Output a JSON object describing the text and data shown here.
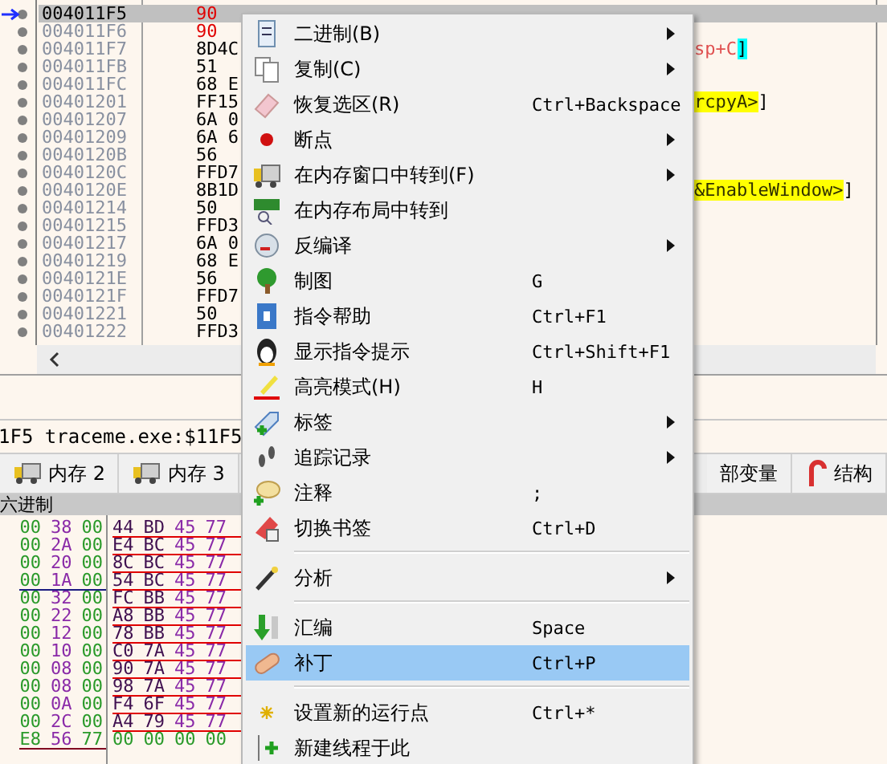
{
  "disassembly": {
    "rows": [
      {
        "address": "004011F5",
        "bytes": "90",
        "selected": true,
        "kind": "nop"
      },
      {
        "address": "004011F6",
        "bytes": "90",
        "selected": false,
        "kind": "nop"
      },
      {
        "address": "004011F7",
        "bytes": "8D4C",
        "selected": false,
        "kind": "normal",
        "tail": {
          "text": "sp+C",
          "end": "]",
          "kind": "register"
        }
      },
      {
        "address": "004011FB",
        "bytes": "51",
        "selected": false,
        "kind": "normal"
      },
      {
        "address": "004011FC",
        "bytes": "68 E",
        "selected": false,
        "kind": "normal"
      },
      {
        "address": "00401201",
        "bytes": "FF15",
        "selected": false,
        "kind": "normal",
        "tail": {
          "text": "rcpyA>",
          "end": "]",
          "kind": "symbol"
        }
      },
      {
        "address": "00401207",
        "bytes": "6A 0",
        "selected": false,
        "kind": "normal"
      },
      {
        "address": "00401209",
        "bytes": "6A 6",
        "selected": false,
        "kind": "normal"
      },
      {
        "address": "0040120B",
        "bytes": "56",
        "selected": false,
        "kind": "normal"
      },
      {
        "address": "0040120C",
        "bytes": "FFD7",
        "selected": false,
        "kind": "normal"
      },
      {
        "address": "0040120E",
        "bytes": "8B1D",
        "selected": false,
        "kind": "normal",
        "tail": {
          "text": "&EnableWindow>",
          "end": "]",
          "kind": "symbol"
        }
      },
      {
        "address": "00401214",
        "bytes": "50",
        "selected": false,
        "kind": "normal"
      },
      {
        "address": "00401215",
        "bytes": "FFD3",
        "selected": false,
        "kind": "normal"
      },
      {
        "address": "00401217",
        "bytes": "6A 0",
        "selected": false,
        "kind": "normal"
      },
      {
        "address": "00401219",
        "bytes": "68 E",
        "selected": false,
        "kind": "normal"
      },
      {
        "address": "0040121E",
        "bytes": "56",
        "selected": false,
        "kind": "normal"
      },
      {
        "address": "0040121F",
        "bytes": "FFD7",
        "selected": false,
        "kind": "normal"
      },
      {
        "address": "00401221",
        "bytes": "50",
        "selected": false,
        "kind": "normal"
      },
      {
        "address": "00401222",
        "bytes": "FFD3",
        "selected": false,
        "kind": "normal"
      }
    ]
  },
  "status": "1F5 traceme.exe:$11F5",
  "tabs": [
    {
      "label": "内存 2"
    },
    {
      "label": "内存 3"
    },
    {
      "label": "部变量"
    },
    {
      "label": "结构"
    }
  ],
  "dump": {
    "header": "六进制",
    "left": [
      {
        "text": "00 38 00"
      },
      {
        "text": "00 2A 00"
      },
      {
        "text": "00 20 00"
      },
      {
        "text": "00 1A 00",
        "color": "#1a1a80"
      },
      {
        "text": "00 32 00"
      },
      {
        "text": "00 22 00"
      },
      {
        "text": "00 12 00"
      },
      {
        "text": "00 10 00"
      },
      {
        "text": "00 08 00"
      },
      {
        "text": "00 08 00"
      },
      {
        "text": "00 0A 00"
      },
      {
        "text": "00 2C 00"
      },
      {
        "text": "E8 56 77",
        "color": "#800020"
      }
    ],
    "right": [
      {
        "text": "44 BD 45 77",
        "color": "#e00000"
      },
      {
        "text": "E4 BC 45 77",
        "color": "#e00000"
      },
      {
        "text": "8C BC 45 77",
        "color": "#e00000"
      },
      {
        "text": "54 BC 45 77",
        "color": "#e00000"
      },
      {
        "text": "FC BB 45 77",
        "color": "#e00000"
      },
      {
        "text": "A8 BB 45 77",
        "color": "#e00000"
      },
      {
        "text": "78 BB 45 77",
        "color": "#e00000"
      },
      {
        "text": "C0 7A 45 77",
        "color": "#e00000"
      },
      {
        "text": "90 7A 45 77",
        "color": "#e00000"
      },
      {
        "text": "98 7A 45 77",
        "color": "#e00000"
      },
      {
        "text": "F4 6F 45 77",
        "color": "#e00000"
      },
      {
        "text": "A4 79 45 77",
        "color": "#e00000"
      },
      {
        "text": "00 00 00 00",
        "kind": "zero"
      }
    ]
  },
  "context_menu": {
    "items": [
      {
        "kind": "item",
        "label": "二进制(B)",
        "submenu": true,
        "selected": false
      },
      {
        "kind": "item",
        "label": "复制(C)",
        "submenu": true,
        "selected": false
      },
      {
        "kind": "item",
        "label": "恢复选区(R)",
        "shortcut": "Ctrl+Backspace",
        "submenu": false,
        "selected": false
      },
      {
        "kind": "item",
        "label": "断点",
        "submenu": true,
        "selected": false
      },
      {
        "kind": "item",
        "label": "在内存窗口中转到(F)",
        "submenu": true,
        "selected": false
      },
      {
        "kind": "item",
        "label": "在内存布局中转到",
        "submenu": false,
        "selected": false
      },
      {
        "kind": "item",
        "label": "反编译",
        "submenu": true,
        "selected": false
      },
      {
        "kind": "item",
        "label": "制图",
        "shortcut": "G",
        "submenu": false,
        "selected": false
      },
      {
        "kind": "item",
        "label": "指令帮助",
        "shortcut": "Ctrl+F1",
        "submenu": false,
        "selected": false
      },
      {
        "kind": "item",
        "label": "显示指令提示",
        "shortcut": "Ctrl+Shift+F1",
        "submenu": false,
        "selected": false
      },
      {
        "kind": "item",
        "label": "高亮模式(H)",
        "shortcut": "H",
        "submenu": false,
        "selected": false
      },
      {
        "kind": "item",
        "label": "标签",
        "submenu": true,
        "selected": false
      },
      {
        "kind": "item",
        "label": "追踪记录",
        "submenu": true,
        "selected": false
      },
      {
        "kind": "item",
        "label": "注释",
        "shortcut": ";",
        "submenu": false,
        "selected": false
      },
      {
        "kind": "item",
        "label": "切换书签",
        "shortcut": "Ctrl+D",
        "submenu": false,
        "selected": false
      },
      {
        "kind": "separator"
      },
      {
        "kind": "item",
        "label": "分析",
        "submenu": true,
        "selected": false
      },
      {
        "kind": "separator"
      },
      {
        "kind": "item",
        "label": "汇编",
        "shortcut": "Space",
        "submenu": false,
        "selected": false
      },
      {
        "kind": "item",
        "label": "补丁",
        "shortcut": "Ctrl+P",
        "submenu": false,
        "selected": true
      },
      {
        "kind": "separator"
      },
      {
        "kind": "item",
        "label": "设置新的运行点",
        "shortcut": "Ctrl+*",
        "submenu": false,
        "selected": false
      },
      {
        "kind": "item",
        "label": "新建线程于此",
        "submenu": false,
        "selected": false
      }
    ]
  }
}
